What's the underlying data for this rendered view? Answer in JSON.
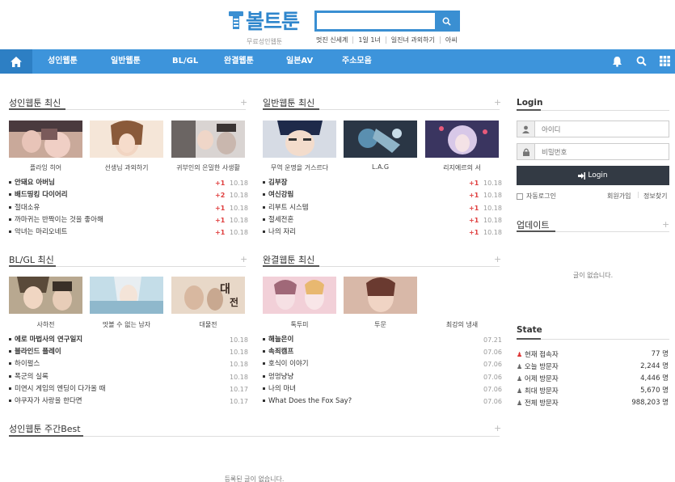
{
  "brand": {
    "logo_text": "볼트툰",
    "subtitle": "무료성인웹툰"
  },
  "search": {
    "placeholder": ""
  },
  "toplinks": [
    "멋진 신세계",
    "1일 1녀",
    "일진녀 과외하기",
    "아씨"
  ],
  "nav": {
    "items": [
      "성인웹툰",
      "일반웹툰",
      "BL/GL",
      "완결웹툰",
      "일본AV",
      "주소모음"
    ],
    "icons": [
      "home-icon",
      "bell-icon",
      "search-icon",
      "grid-icon"
    ]
  },
  "colors": {
    "nav_bg": "#3d94db",
    "nav_home": "#2d7fc4",
    "accent_red": "#e04040",
    "login_btn": "#333a44"
  },
  "sections": {
    "adult": {
      "title": "성인웹툰 최신",
      "thumbs": [
        "플라잉 히어",
        "선생님 과외하기",
        "귀부인의 은밀한 사생활"
      ],
      "rows": [
        {
          "t": "안돼요 아버님",
          "bold": true,
          "c": "+1",
          "d": "10.18"
        },
        {
          "t": "배드띵킹 다이어리",
          "bold": true,
          "c": "+2",
          "d": "10.18"
        },
        {
          "t": "절대소유",
          "bold": false,
          "c": "+1",
          "d": "10.18"
        },
        {
          "t": "까마귀는 반짝이는 것을 좋아해",
          "bold": false,
          "c": "+1",
          "d": "10.18"
        },
        {
          "t": "악녀는 마리오네트",
          "bold": false,
          "c": "+1",
          "d": "10.18"
        }
      ]
    },
    "general": {
      "title": "일반웹툰 최신",
      "thumbs": [
        "무역 운명을 거스르다",
        "L.A.G",
        "리지에르의 서"
      ],
      "rows": [
        {
          "t": "김부장",
          "bold": true,
          "c": "+1",
          "d": "10.18"
        },
        {
          "t": "여신강림",
          "bold": true,
          "c": "+1",
          "d": "10.18"
        },
        {
          "t": "리부트 시스템",
          "bold": false,
          "c": "+1",
          "d": "10.18"
        },
        {
          "t": "절세전혼",
          "bold": false,
          "c": "+1",
          "d": "10.18"
        },
        {
          "t": "나의 자리",
          "bold": false,
          "c": "+1",
          "d": "10.18"
        }
      ]
    },
    "blgl": {
      "title": "BL/GL 최신",
      "thumbs": [
        "사하전",
        "맛볼 수 없는 남자",
        "대물전"
      ],
      "rows": [
        {
          "t": "에로 마법사의 연구일지",
          "bold": true,
          "d": "10.18"
        },
        {
          "t": "블라인드 플레이",
          "bold": true,
          "d": "10.18"
        },
        {
          "t": "하이펄스",
          "bold": false,
          "d": "10.18"
        },
        {
          "t": "폭군의 실록",
          "bold": false,
          "d": "10.18"
        },
        {
          "t": "미연시 게임의 엔딩이 다가올 때",
          "bold": false,
          "d": "10.17"
        },
        {
          "t": "야쿠자가 사랑을 한다면",
          "bold": false,
          "d": "10.17"
        }
      ]
    },
    "complete": {
      "title": "완결웹툰 최신",
      "thumbs": [
        "톡투미",
        "투문",
        "최강의 냉새"
      ],
      "rows": [
        {
          "t": "해늘은이",
          "bold": true,
          "d": "07.21"
        },
        {
          "t": "속죄캠프",
          "bold": true,
          "d": "07.06"
        },
        {
          "t": "호식이 이야기",
          "bold": false,
          "d": "07.06"
        },
        {
          "t": "멍멍냥냥",
          "bold": false,
          "d": "07.06"
        },
        {
          "t": "나의 마녀",
          "bold": false,
          "d": "07.06"
        },
        {
          "t": "What Does the Fox Say?",
          "bold": false,
          "d": "07.06"
        }
      ]
    },
    "weekly": {
      "title": "성인웹툰 주간Best",
      "empty": "등록된 글이 없습니다."
    }
  },
  "sidebar": {
    "login": {
      "title": "Login",
      "id_placeholder": "아이디",
      "pw_placeholder": "비밀번호",
      "button": "Login",
      "auto_login": "자동로그인",
      "register": "회원가입",
      "find": "정보찾기"
    },
    "update": {
      "title": "업데이트",
      "empty": "글이 없습니다."
    },
    "state": {
      "title": "State",
      "rows": [
        {
          "label": "현재 접속자",
          "value": "77 명"
        },
        {
          "label": "오늘 방문자",
          "value": "2,244 명"
        },
        {
          "label": "어제 방문자",
          "value": "4,446 명"
        },
        {
          "label": "최대 방문자",
          "value": "5,670 명"
        },
        {
          "label": "전체 방문자",
          "value": "988,203 명"
        }
      ]
    }
  }
}
